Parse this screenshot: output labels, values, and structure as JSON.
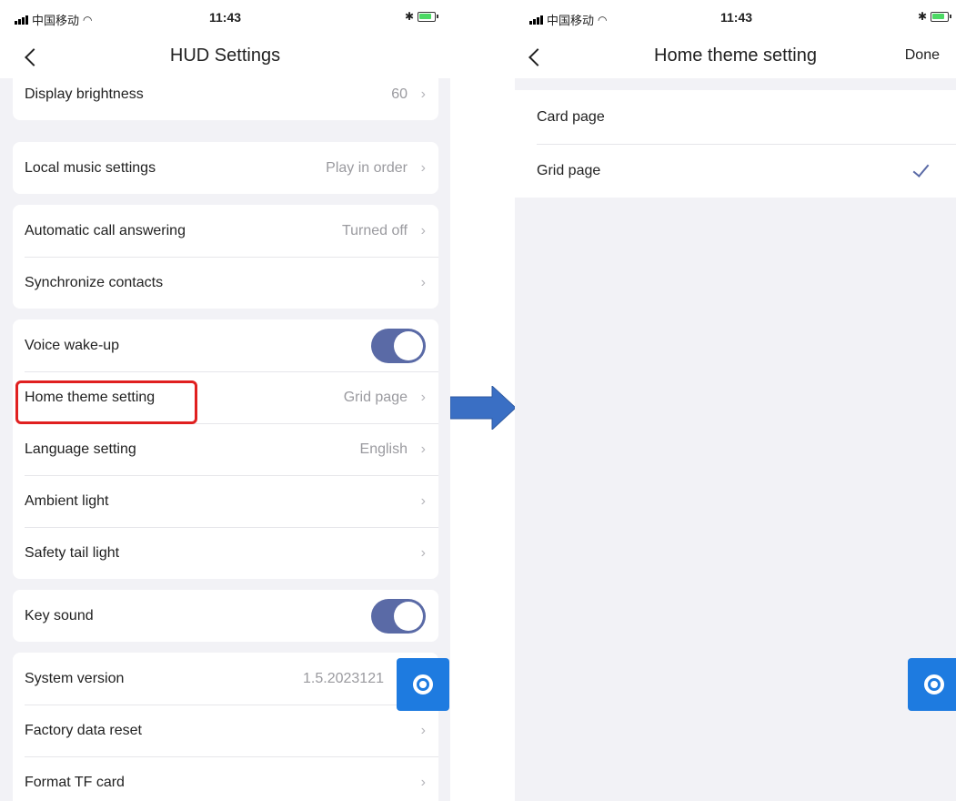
{
  "left_screen": {
    "status": {
      "carrier": "中国移动",
      "time": "11:43"
    },
    "title": "HUD Settings",
    "groups": [
      {
        "rows": [
          {
            "label": "Display brightness",
            "value": "60"
          }
        ]
      },
      {
        "rows": [
          {
            "label": "Local music settings",
            "value": "Play in order"
          }
        ]
      },
      {
        "rows": [
          {
            "label": "Automatic call answering",
            "value": "Turned off"
          },
          {
            "label": "Synchronize contacts",
            "value": ""
          }
        ]
      },
      {
        "rows": [
          {
            "label": "Voice wake-up",
            "toggle": true
          },
          {
            "label": "Home theme setting",
            "value": "Grid page"
          },
          {
            "label": "Language setting",
            "value": "English"
          },
          {
            "label": "Ambient light",
            "value": ""
          },
          {
            "label": "Safety tail light",
            "value": ""
          }
        ]
      },
      {
        "rows": [
          {
            "label": "Key sound",
            "toggle": true
          }
        ]
      },
      {
        "rows": [
          {
            "label": "System version",
            "value": "1.5.2023121"
          },
          {
            "label": "Factory data reset",
            "value": ""
          },
          {
            "label": "Format TF card",
            "value": ""
          }
        ]
      }
    ]
  },
  "right_screen": {
    "status": {
      "carrier": "中国移动",
      "time": "11:43"
    },
    "title": "Home theme setting",
    "done_label": "Done",
    "options": [
      {
        "label": "Card page",
        "selected": false
      },
      {
        "label": "Grid page",
        "selected": true
      }
    ]
  },
  "colors": {
    "toggle_on": "#5a6aa6",
    "fab": "#1e7be0",
    "highlight": "#e02020",
    "arrow": "#3a6fc4"
  }
}
